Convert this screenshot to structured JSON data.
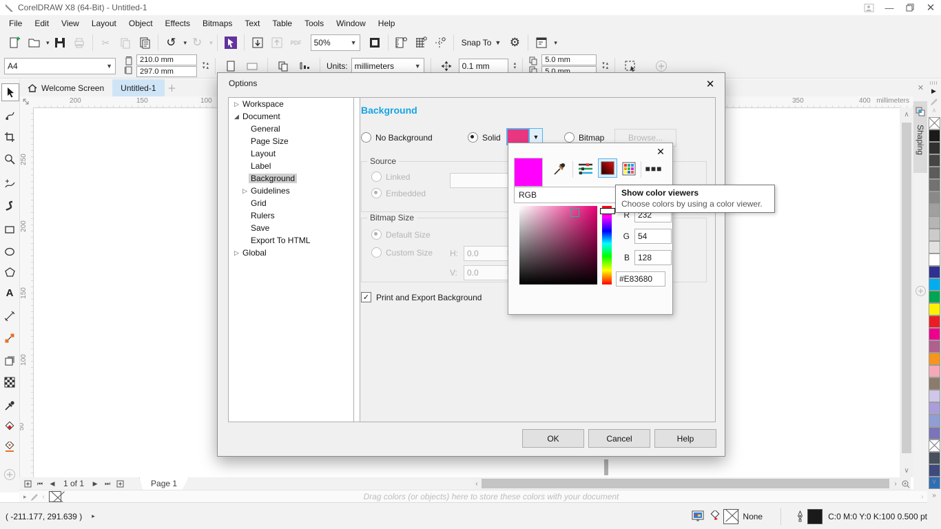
{
  "window": {
    "title": "CorelDRAW X8 (64-Bit) - Untitled-1"
  },
  "menu": [
    "File",
    "Edit",
    "View",
    "Layout",
    "Object",
    "Effects",
    "Bitmaps",
    "Text",
    "Table",
    "Tools",
    "Window",
    "Help"
  ],
  "toolbar": {
    "zoom_value": "50%",
    "snap_to_label": "Snap To",
    "pdf_label": "PDF"
  },
  "property_bar": {
    "preset": "A4",
    "width": "210.0 mm",
    "height": "297.0 mm",
    "units_label": "Units:",
    "units": "millimeters",
    "nudge": "0.1 mm",
    "dup_x": "5.0 mm",
    "dup_y": "5.0 mm"
  },
  "doc_tabs": {
    "welcome": "Welcome Screen",
    "current": "Untitled-1"
  },
  "rulers": {
    "top": [
      "200",
      "150",
      "100",
      "350",
      "400"
    ],
    "unit": "millimeters",
    "left": [
      "250",
      "200",
      "150",
      "100",
      "50"
    ]
  },
  "options_dialog": {
    "title": "Options",
    "tree": [
      {
        "label": "Workspace",
        "state": "collapsed",
        "level": 0,
        "selected": false
      },
      {
        "label": "Document",
        "state": "expanded",
        "level": 0,
        "selected": false
      },
      {
        "label": "General",
        "level": 1,
        "selected": false
      },
      {
        "label": "Page Size",
        "level": 1,
        "selected": false
      },
      {
        "label": "Layout",
        "level": 1,
        "selected": false
      },
      {
        "label": "Label",
        "level": 1,
        "selected": false
      },
      {
        "label": "Background",
        "level": 1,
        "selected": true
      },
      {
        "label": "Guidelines",
        "state": "collapsed",
        "level": 1,
        "selected": false
      },
      {
        "label": "Grid",
        "level": 1,
        "selected": false
      },
      {
        "label": "Rulers",
        "level": 1,
        "selected": false
      },
      {
        "label": "Save",
        "level": 1,
        "selected": false
      },
      {
        "label": "Export To HTML",
        "level": 1,
        "selected": false
      },
      {
        "label": "Global",
        "state": "collapsed",
        "level": 0,
        "selected": false
      }
    ],
    "heading": "Background",
    "no_background": "No Background",
    "solid": "Solid",
    "bitmap": "Bitmap",
    "browse": "Browse...",
    "solid_color": "#E83680",
    "source": {
      "title": "Source",
      "linked": "Linked",
      "embedded": "Embedded",
      "path_value": ""
    },
    "bitmap_size": {
      "title": "Bitmap Size",
      "default_size": "Default Size",
      "custom_size": "Custom Size",
      "h_label": "H:",
      "h_value": "0.0",
      "v_label": "V:",
      "v_value": "0.0"
    },
    "print_export": "Print and Export Background",
    "ok": "OK",
    "cancel": "Cancel",
    "help": "Help"
  },
  "color_picker": {
    "model": "RGB",
    "r_label": "R",
    "r_value": "232",
    "g_label": "G",
    "g_value": "54",
    "b_label": "B",
    "b_value": "128",
    "hex_value": "#E83680",
    "preview_color": "#FF00FF"
  },
  "tooltip": {
    "title": "Show color viewers",
    "text": "Choose colors by using a color viewer."
  },
  "navigation": {
    "page_info": "1 of 1",
    "page_tab": "Page 1"
  },
  "document_palette_hint": "Drag colors (or objects) here to store these colors with your document",
  "status_bar": {
    "coords": "( -211.177, 291.639 )",
    "fill_none": "None",
    "outline": "C:0 M:0 Y:0 K:100  0.500 pt"
  },
  "docker": {
    "tab_label": "Shaping"
  },
  "color_palette": [
    "none",
    "#1a1a18",
    "#30302e",
    "#454543",
    "#5c5c5a",
    "#727270",
    "#898987",
    "#a0a09e",
    "#b5b5b3",
    "#cbcbc9",
    "#e1e1df",
    "#ffffff",
    "#2e3192",
    "#00aeef",
    "#00a651",
    "#fff200",
    "#ed1c24",
    "#ec008c",
    "#b05f8e",
    "#f7941d",
    "#f5a9b8",
    "#8c7b6a",
    "#cfc6e8",
    "#ab9ed8",
    "#8f9fd4",
    "#7b74b9",
    "none",
    "#47505c",
    "#3e4a7c",
    "#2d6fb7"
  ]
}
